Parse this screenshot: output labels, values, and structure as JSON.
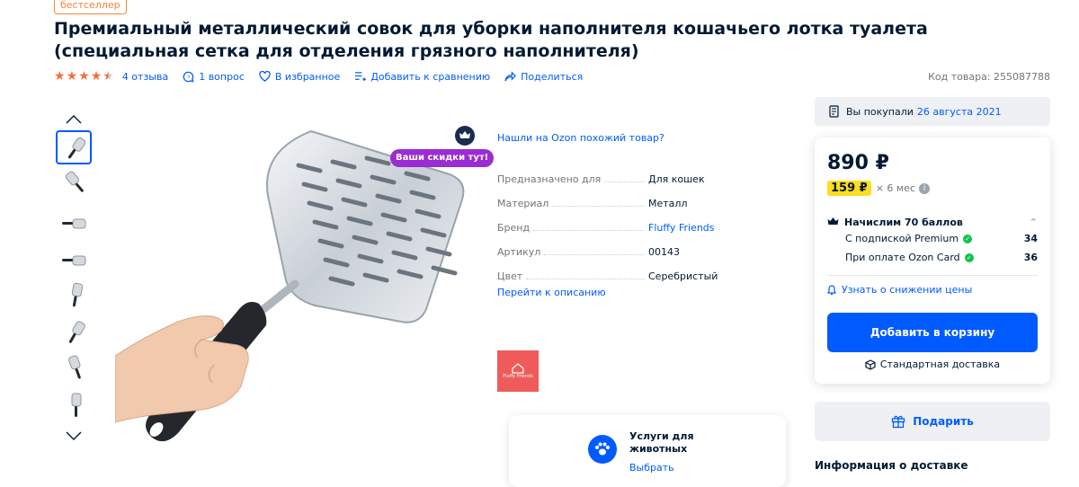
{
  "badge": "бестселлер",
  "title": "Премиальный металлический совок для уборки наполнителя кошачьего лотка туалета (специальная сетка для отделения грязного наполнителя)",
  "rating": {
    "value": 4.5,
    "max": 5
  },
  "meta": {
    "reviews": "4 отзыва",
    "questions": "1 вопрос",
    "favorite": "В избранное",
    "compare": "Добавить к сравнению",
    "share": "Поделиться"
  },
  "product_code": "Код товара: 255087788",
  "gallery": {
    "thumb_count": 8,
    "selected_index": 0
  },
  "promo": {
    "discount_label": "Ваши скидки тут!"
  },
  "similar_link": "Нашли на Ozon похожий товар?",
  "specs": [
    {
      "name": "Предназначено для",
      "value": "Для кошек",
      "link": false
    },
    {
      "name": "Материал",
      "value": "Металл",
      "link": false
    },
    {
      "name": "Бренд",
      "value": "Fluffy Friends",
      "link": true
    },
    {
      "name": "Артикул",
      "value": "00143",
      "link": false
    },
    {
      "name": "Цвет",
      "value": "Серебристый",
      "link": false
    }
  ],
  "to_description": "Перейти к описанию",
  "brand_logo_text": "Fluffy Friends",
  "services": {
    "title": "Услуги для животных",
    "link": "Выбрать"
  },
  "purchase": {
    "label": "Вы покупали",
    "date": "26 августа 2021"
  },
  "price": "890 ₽",
  "installment": {
    "amount": "159 ₽",
    "term": "× 6 мес",
    "info": "i"
  },
  "points": {
    "title": "Начислим 70 баллов",
    "rows": [
      {
        "label": "С подпиской Premium",
        "value": "34"
      },
      {
        "label": "При оплате Ozon Card",
        "value": "36"
      }
    ]
  },
  "notify": "Узнать о снижении цены",
  "cart_button": "Добавить в корзину",
  "delivery": "Стандартная доставка",
  "gift_button": "Подарить",
  "delivery_info": "Информация о доставке",
  "colors": {
    "accent": "#005bff",
    "star": "#f76d3b",
    "badge": "#f0863a",
    "promo": "#9a2cd1",
    "installment": "#ffdc1f"
  }
}
